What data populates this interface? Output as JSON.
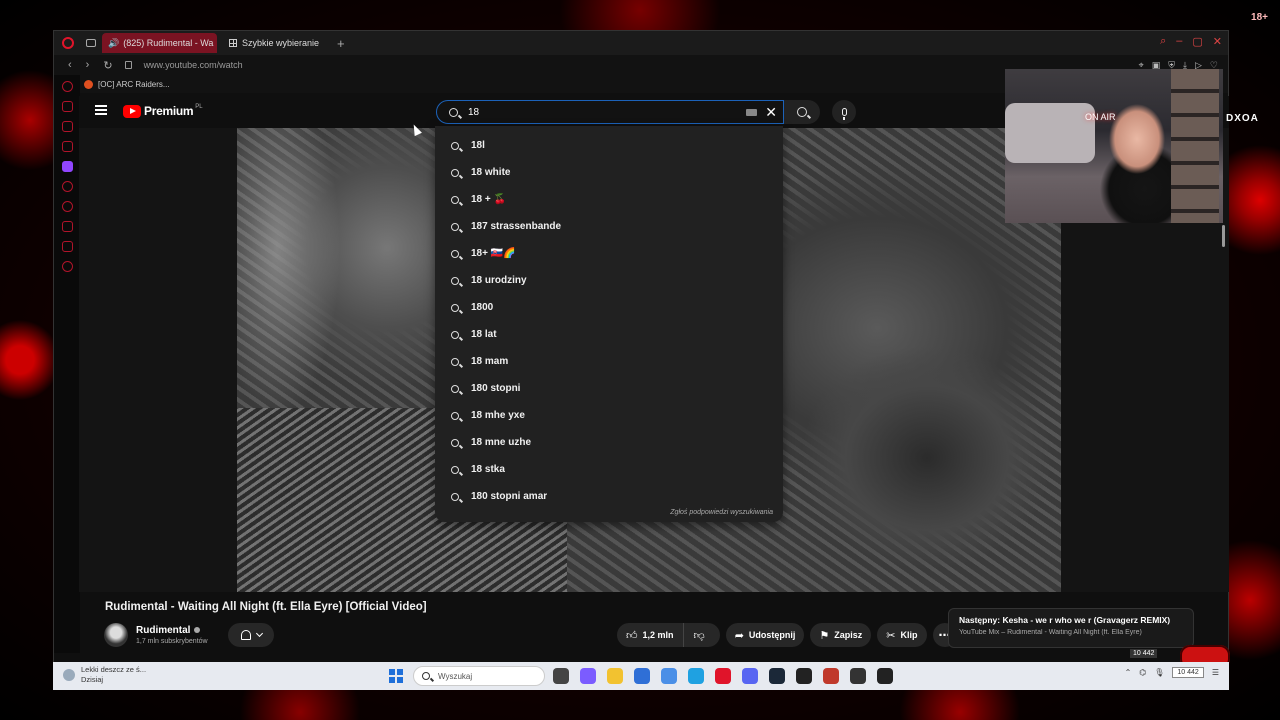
{
  "overlay": {
    "corner_text": "18+"
  },
  "browser": {
    "tabs": [
      {
        "label": "(825) Rudimental - Wa",
        "active": true
      },
      {
        "label": "Szybkie wybieranie",
        "active": false
      }
    ],
    "url": "www.youtube.com/watch",
    "bookmark": "[OC] ARC Raiders..."
  },
  "youtube": {
    "logo_text": "Premium",
    "region": "PL",
    "search_value": "18",
    "suggestions": [
      "18l",
      "18 white",
      "18 + 🍒",
      "187 strassenbande",
      "18+ 🇸🇰🌈",
      "18 urodziny",
      "1800",
      "18 lat",
      "18 mam",
      "180 stopni",
      "18 mhe yxe",
      "18 mne uzhe",
      "18 stka",
      "180 stopni amar"
    ],
    "report_text": "Zgłoś podpowiedzi wyszukiwania",
    "video_title": "Rudimental - Waiting All Night (ft. Ella Eyre) [Official Video]",
    "channel_name": "Rudimental",
    "subscribers": "1,7 mln subskrybentów",
    "likes": "1,2 mln",
    "share_label": "Udostępnij",
    "save_label": "Zapisz",
    "clip_label": "Klip",
    "next_title": "Następny: Kesha - we r who we r (Gravagerz REMIX)",
    "next_sub": "YouTube Mix – Rudimental - Waiting All Night (ft. Ella Eyre)"
  },
  "webcam": {
    "on_air": "ON AIR",
    "brand": "DXOA"
  },
  "taskbar": {
    "weather_line1": "Lekki deszcz ze ś...",
    "weather_line2": "Dzisiaj",
    "search_placeholder": "Wyszukaj",
    "counter": "10 442",
    "app_colors": [
      "#444444",
      "#7b5cff",
      "#f2c230",
      "#2f6fd6",
      "#4a8fe7",
      "#1fa1e1",
      "#e0142a",
      "#5865f2",
      "#1b2838",
      "#222222",
      "#c0392b",
      "#333333",
      "#222222"
    ]
  },
  "colors": {
    "accent": "#e0142a",
    "yt_red": "#ff0000",
    "search_border": "#1c62b9"
  }
}
